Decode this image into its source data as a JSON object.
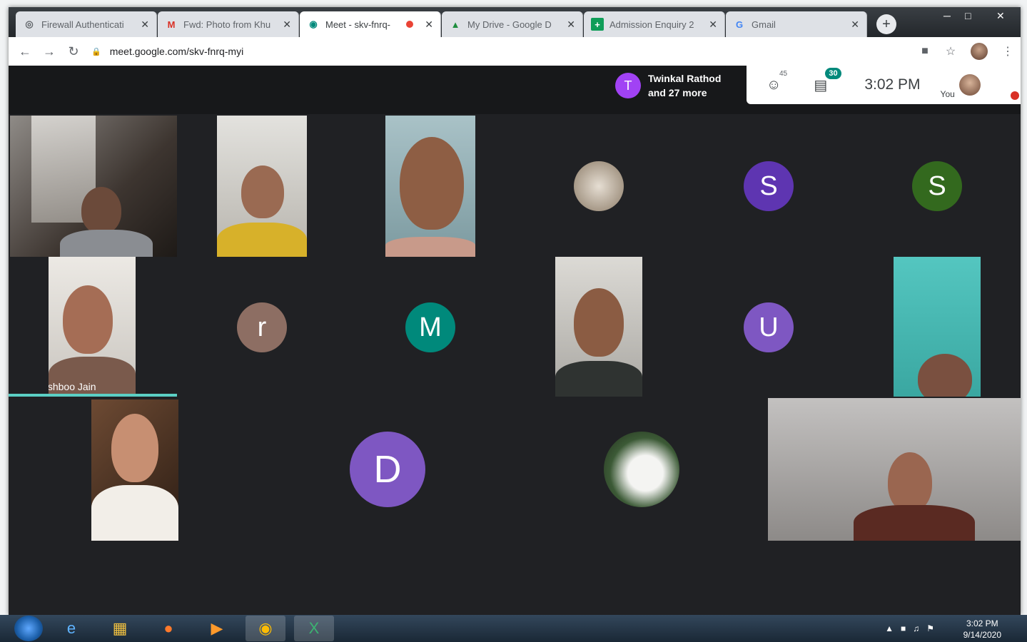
{
  "browser": {
    "tabs": [
      {
        "label": "Firewall Authenticati",
        "favicon": "globe-icon"
      },
      {
        "label": "Fwd: Photo from Khu",
        "favicon": "gmail-icon"
      },
      {
        "label": "Meet - skv-fnrq-",
        "favicon": "meet-icon",
        "recording": true
      },
      {
        "label": "My Drive - Google D",
        "favicon": "drive-icon"
      },
      {
        "label": "Admission Enquiry 2",
        "favicon": "sheets-icon"
      },
      {
        "label": "Gmail",
        "favicon": "google-icon"
      }
    ],
    "url": "meet.google.com/skv-fnrq-myi"
  },
  "meet": {
    "presenter_initial": "T",
    "presenter_name": "Twinkal Rathod",
    "presenter_more": "and 27 more",
    "participants_count": "45",
    "chat_count": "30",
    "time": "3:02 PM",
    "you_label": "You",
    "participants": [
      {
        "type": "avatar",
        "initial": "S",
        "color": "#5e35b1"
      },
      {
        "type": "avatar",
        "initial": "S",
        "color": "#33691e"
      },
      {
        "type": "avatar",
        "initial": "r",
        "color": "#8d6e63"
      },
      {
        "type": "avatar",
        "initial": "M",
        "color": "#00897b"
      },
      {
        "type": "avatar",
        "initial": "U",
        "color": "#7e57c2"
      },
      {
        "type": "avatar",
        "initial": "D",
        "color": "#7e57c2"
      }
    ],
    "active_speaker": "Khushboo Jain",
    "accent": "#5bcfc4"
  },
  "taskbar": {
    "time": "3:02 PM",
    "date": "9/14/2020"
  }
}
